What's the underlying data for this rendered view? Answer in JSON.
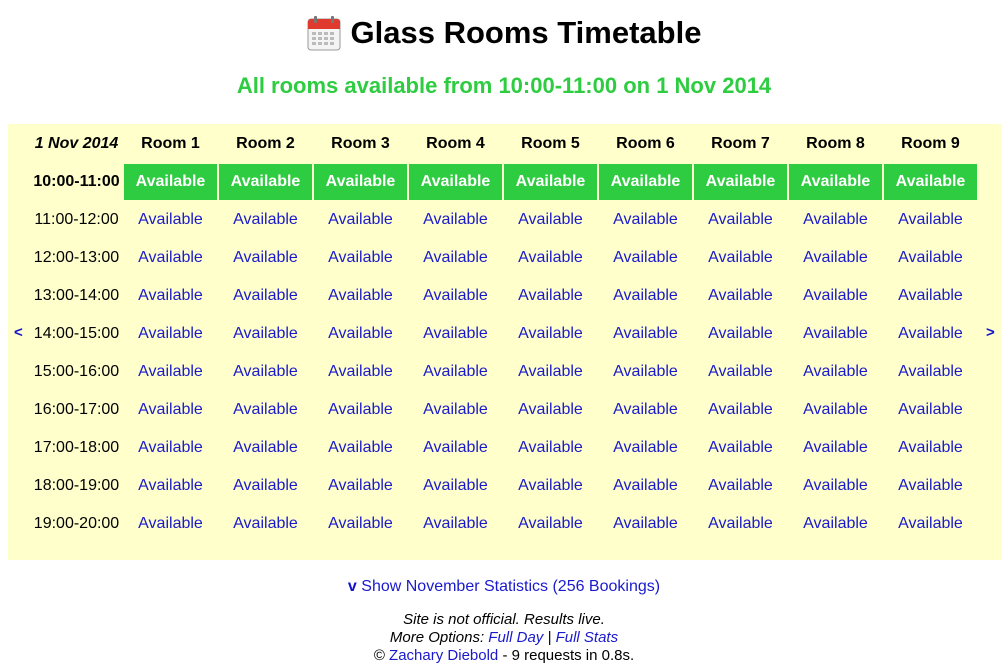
{
  "header": {
    "title": "Glass Rooms Timetable",
    "icon": "calendar-icon",
    "subtitle": "All rooms available from 10:00-11:00 on 1 Nov 2014",
    "subtitle_color": "#2ecc40"
  },
  "timetable": {
    "date_label": "1 Nov 2014",
    "prev_label": "<",
    "next_label": ">",
    "rooms": [
      "Room 1",
      "Room 2",
      "Room 3",
      "Room 4",
      "Room 5",
      "Room 6",
      "Room 7",
      "Room 8",
      "Room 9"
    ],
    "rows": [
      {
        "slot": "10:00-11:00",
        "current": true,
        "cells": [
          "Available",
          "Available",
          "Available",
          "Available",
          "Available",
          "Available",
          "Available",
          "Available",
          "Available"
        ]
      },
      {
        "slot": "11:00-12:00",
        "current": false,
        "cells": [
          "Available",
          "Available",
          "Available",
          "Available",
          "Available",
          "Available",
          "Available",
          "Available",
          "Available"
        ]
      },
      {
        "slot": "12:00-13:00",
        "current": false,
        "cells": [
          "Available",
          "Available",
          "Available",
          "Available",
          "Available",
          "Available",
          "Available",
          "Available",
          "Available"
        ]
      },
      {
        "slot": "13:00-14:00",
        "current": false,
        "cells": [
          "Available",
          "Available",
          "Available",
          "Available",
          "Available",
          "Available",
          "Available",
          "Available",
          "Available"
        ]
      },
      {
        "slot": "14:00-15:00",
        "current": false,
        "cells": [
          "Available",
          "Available",
          "Available",
          "Available",
          "Available",
          "Available",
          "Available",
          "Available",
          "Available"
        ]
      },
      {
        "slot": "15:00-16:00",
        "current": false,
        "cells": [
          "Available",
          "Available",
          "Available",
          "Available",
          "Available",
          "Available",
          "Available",
          "Available",
          "Available"
        ]
      },
      {
        "slot": "16:00-17:00",
        "current": false,
        "cells": [
          "Available",
          "Available",
          "Available",
          "Available",
          "Available",
          "Available",
          "Available",
          "Available",
          "Available"
        ]
      },
      {
        "slot": "17:00-18:00",
        "current": false,
        "cells": [
          "Available",
          "Available",
          "Available",
          "Available",
          "Available",
          "Available",
          "Available",
          "Available",
          "Available"
        ]
      },
      {
        "slot": "18:00-19:00",
        "current": false,
        "cells": [
          "Available",
          "Available",
          "Available",
          "Available",
          "Available",
          "Available",
          "Available",
          "Available",
          "Available"
        ]
      },
      {
        "slot": "19:00-20:00",
        "current": false,
        "cells": [
          "Available",
          "Available",
          "Available",
          "Available",
          "Available",
          "Available",
          "Available",
          "Available",
          "Available"
        ]
      }
    ],
    "colors": {
      "cell_bg": "#ffffcc",
      "current_bg": "#2ecc40",
      "link": "#1a1acc"
    }
  },
  "stats": {
    "toggle": "v",
    "link_text": "Show November Statistics (256 Bookings)"
  },
  "footer": {
    "line1": "Site is not official. Results live.",
    "more_options": "More Options:",
    "full_day": "Full Day",
    "separator": "|",
    "full_stats": "Full Stats",
    "copyright": "©",
    "author": "Zachary Diebold",
    "requests": "- 9 requests in 0.8s."
  }
}
